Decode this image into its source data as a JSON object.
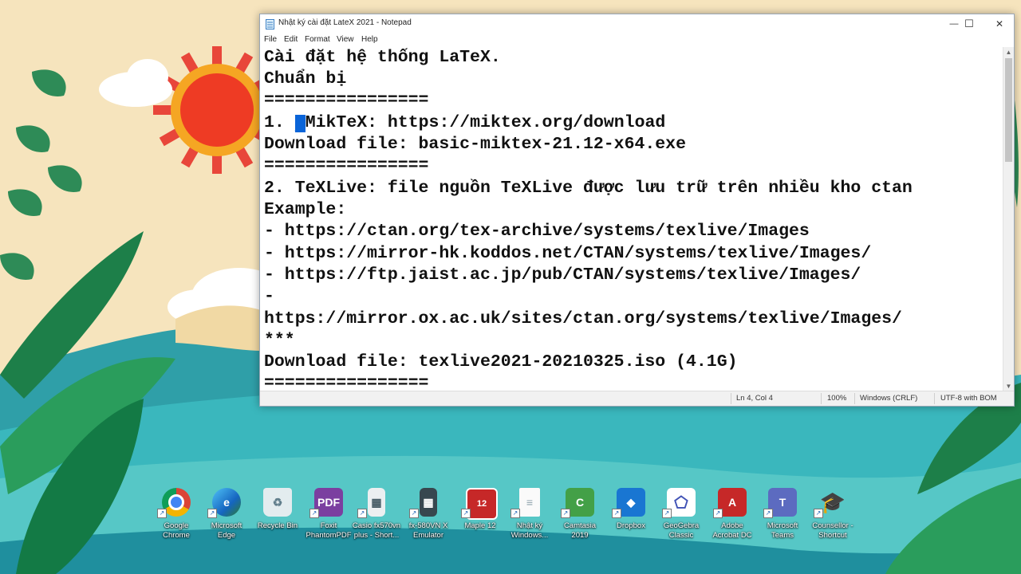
{
  "window": {
    "title": "Nhật ký cài đặt LateX 2021 - Notepad",
    "controls": {
      "minimize": "—",
      "maximize": "☐",
      "close": "✕"
    }
  },
  "menu": [
    "File",
    "Edit",
    "Format",
    "View",
    "Help"
  ],
  "editor": {
    "lines": [
      "Cài đặt hệ thống LaTeX.",
      "Chuẩn bị",
      "================",
      "1. ",
      "MikTeX: https://miktex.org/download",
      "Download file: basic-miktex-21.12-x64.exe",
      "================",
      "2. TeXLive: file nguồn TeXLive được lưu trữ trên nhiều kho ctan",
      "Example:",
      "- https://ctan.org/tex-archive/systems/texlive/Images",
      "- https://mirror-hk.koddos.net/CTAN/systems/texlive/Images/",
      "- https://ftp.jaist.ac.jp/pub/CTAN/systems/texlive/Images/",
      "-",
      "https://mirror.ox.ac.uk/sites/ctan.org/systems/texlive/Images/",
      "***",
      "Download file: texlive2021-20210325.iso (4.1G)",
      "================"
    ]
  },
  "status": {
    "position": "Ln 4, Col 4",
    "zoom": "100%",
    "line_ending": "Windows (CRLF)",
    "encoding": "UTF-8 with BOM"
  },
  "desktop_icons": [
    {
      "line1": "Google",
      "line2": "Chrome",
      "icon": "chrome-icon",
      "color": "#ffffff"
    },
    {
      "line1": "Microsoft",
      "line2": "Edge",
      "icon": "edge-icon",
      "color": "#1e88e5"
    },
    {
      "line1": "Recycle Bin",
      "line2": "",
      "icon": "recycle-bin-icon",
      "color": "#cfd8dc"
    },
    {
      "line1": "Foxit",
      "line2": "PhantomPDF",
      "icon": "foxit-icon",
      "color": "#7b3fa0"
    },
    {
      "line1": "Casio fx570vn",
      "line2": "plus - Short...",
      "icon": "calculator-icon",
      "color": "#eceff1"
    },
    {
      "line1": "fx-580VN X",
      "line2": "Emulator",
      "icon": "calculator-icon",
      "color": "#37474f"
    },
    {
      "line1": "Maple 12",
      "line2": "",
      "icon": "maple-icon",
      "color": "#c62828"
    },
    {
      "line1": "Nhật ký",
      "line2": "Windows...",
      "icon": "document-icon",
      "color": "#fafafa"
    },
    {
      "line1": "Camtasia",
      "line2": "2019",
      "icon": "camtasia-icon",
      "color": "#43a047"
    },
    {
      "line1": "Dropbox",
      "line2": "",
      "icon": "dropbox-icon",
      "color": "#1976d2"
    },
    {
      "line1": "GeoGebra",
      "line2": "Classic",
      "icon": "geogebra-icon",
      "color": "#ffffff"
    },
    {
      "line1": "Adobe",
      "line2": "Acrobat DC",
      "icon": "acrobat-icon",
      "color": "#c62828"
    },
    {
      "line1": "Microsoft",
      "line2": "Teams",
      "icon": "teams-icon",
      "color": "#5c6bc0"
    },
    {
      "line1": "Counsellor -",
      "line2": "Shortcut",
      "icon": "graduation-cap-icon",
      "color": "#263238"
    }
  ]
}
